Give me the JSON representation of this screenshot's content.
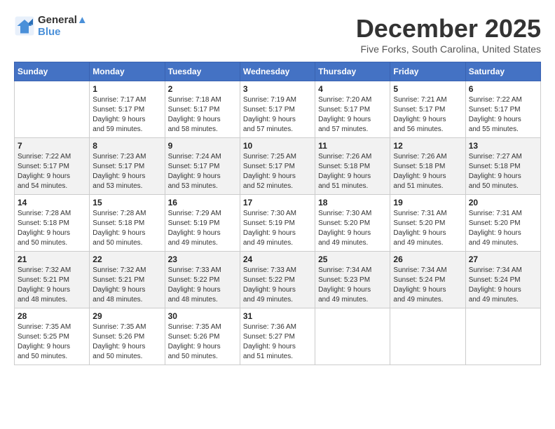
{
  "header": {
    "logo_line1": "General",
    "logo_line2": "Blue",
    "month_title": "December 2025",
    "subtitle": "Five Forks, South Carolina, United States"
  },
  "weekdays": [
    "Sunday",
    "Monday",
    "Tuesday",
    "Wednesday",
    "Thursday",
    "Friday",
    "Saturday"
  ],
  "weeks": [
    [
      {
        "day": "",
        "info": ""
      },
      {
        "day": "1",
        "info": "Sunrise: 7:17 AM\nSunset: 5:17 PM\nDaylight: 9 hours\nand 59 minutes."
      },
      {
        "day": "2",
        "info": "Sunrise: 7:18 AM\nSunset: 5:17 PM\nDaylight: 9 hours\nand 58 minutes."
      },
      {
        "day": "3",
        "info": "Sunrise: 7:19 AM\nSunset: 5:17 PM\nDaylight: 9 hours\nand 57 minutes."
      },
      {
        "day": "4",
        "info": "Sunrise: 7:20 AM\nSunset: 5:17 PM\nDaylight: 9 hours\nand 57 minutes."
      },
      {
        "day": "5",
        "info": "Sunrise: 7:21 AM\nSunset: 5:17 PM\nDaylight: 9 hours\nand 56 minutes."
      },
      {
        "day": "6",
        "info": "Sunrise: 7:22 AM\nSunset: 5:17 PM\nDaylight: 9 hours\nand 55 minutes."
      }
    ],
    [
      {
        "day": "7",
        "info": "Sunrise: 7:22 AM\nSunset: 5:17 PM\nDaylight: 9 hours\nand 54 minutes."
      },
      {
        "day": "8",
        "info": "Sunrise: 7:23 AM\nSunset: 5:17 PM\nDaylight: 9 hours\nand 53 minutes."
      },
      {
        "day": "9",
        "info": "Sunrise: 7:24 AM\nSunset: 5:17 PM\nDaylight: 9 hours\nand 53 minutes."
      },
      {
        "day": "10",
        "info": "Sunrise: 7:25 AM\nSunset: 5:17 PM\nDaylight: 9 hours\nand 52 minutes."
      },
      {
        "day": "11",
        "info": "Sunrise: 7:26 AM\nSunset: 5:18 PM\nDaylight: 9 hours\nand 51 minutes."
      },
      {
        "day": "12",
        "info": "Sunrise: 7:26 AM\nSunset: 5:18 PM\nDaylight: 9 hours\nand 51 minutes."
      },
      {
        "day": "13",
        "info": "Sunrise: 7:27 AM\nSunset: 5:18 PM\nDaylight: 9 hours\nand 50 minutes."
      }
    ],
    [
      {
        "day": "14",
        "info": "Sunrise: 7:28 AM\nSunset: 5:18 PM\nDaylight: 9 hours\nand 50 minutes."
      },
      {
        "day": "15",
        "info": "Sunrise: 7:28 AM\nSunset: 5:18 PM\nDaylight: 9 hours\nand 50 minutes."
      },
      {
        "day": "16",
        "info": "Sunrise: 7:29 AM\nSunset: 5:19 PM\nDaylight: 9 hours\nand 49 minutes."
      },
      {
        "day": "17",
        "info": "Sunrise: 7:30 AM\nSunset: 5:19 PM\nDaylight: 9 hours\nand 49 minutes."
      },
      {
        "day": "18",
        "info": "Sunrise: 7:30 AM\nSunset: 5:20 PM\nDaylight: 9 hours\nand 49 minutes."
      },
      {
        "day": "19",
        "info": "Sunrise: 7:31 AM\nSunset: 5:20 PM\nDaylight: 9 hours\nand 49 minutes."
      },
      {
        "day": "20",
        "info": "Sunrise: 7:31 AM\nSunset: 5:20 PM\nDaylight: 9 hours\nand 49 minutes."
      }
    ],
    [
      {
        "day": "21",
        "info": "Sunrise: 7:32 AM\nSunset: 5:21 PM\nDaylight: 9 hours\nand 48 minutes."
      },
      {
        "day": "22",
        "info": "Sunrise: 7:32 AM\nSunset: 5:21 PM\nDaylight: 9 hours\nand 48 minutes."
      },
      {
        "day": "23",
        "info": "Sunrise: 7:33 AM\nSunset: 5:22 PM\nDaylight: 9 hours\nand 48 minutes."
      },
      {
        "day": "24",
        "info": "Sunrise: 7:33 AM\nSunset: 5:22 PM\nDaylight: 9 hours\nand 49 minutes."
      },
      {
        "day": "25",
        "info": "Sunrise: 7:34 AM\nSunset: 5:23 PM\nDaylight: 9 hours\nand 49 minutes."
      },
      {
        "day": "26",
        "info": "Sunrise: 7:34 AM\nSunset: 5:24 PM\nDaylight: 9 hours\nand 49 minutes."
      },
      {
        "day": "27",
        "info": "Sunrise: 7:34 AM\nSunset: 5:24 PM\nDaylight: 9 hours\nand 49 minutes."
      }
    ],
    [
      {
        "day": "28",
        "info": "Sunrise: 7:35 AM\nSunset: 5:25 PM\nDaylight: 9 hours\nand 50 minutes."
      },
      {
        "day": "29",
        "info": "Sunrise: 7:35 AM\nSunset: 5:26 PM\nDaylight: 9 hours\nand 50 minutes."
      },
      {
        "day": "30",
        "info": "Sunrise: 7:35 AM\nSunset: 5:26 PM\nDaylight: 9 hours\nand 50 minutes."
      },
      {
        "day": "31",
        "info": "Sunrise: 7:36 AM\nSunset: 5:27 PM\nDaylight: 9 hours\nand 51 minutes."
      },
      {
        "day": "",
        "info": ""
      },
      {
        "day": "",
        "info": ""
      },
      {
        "day": "",
        "info": ""
      }
    ]
  ]
}
